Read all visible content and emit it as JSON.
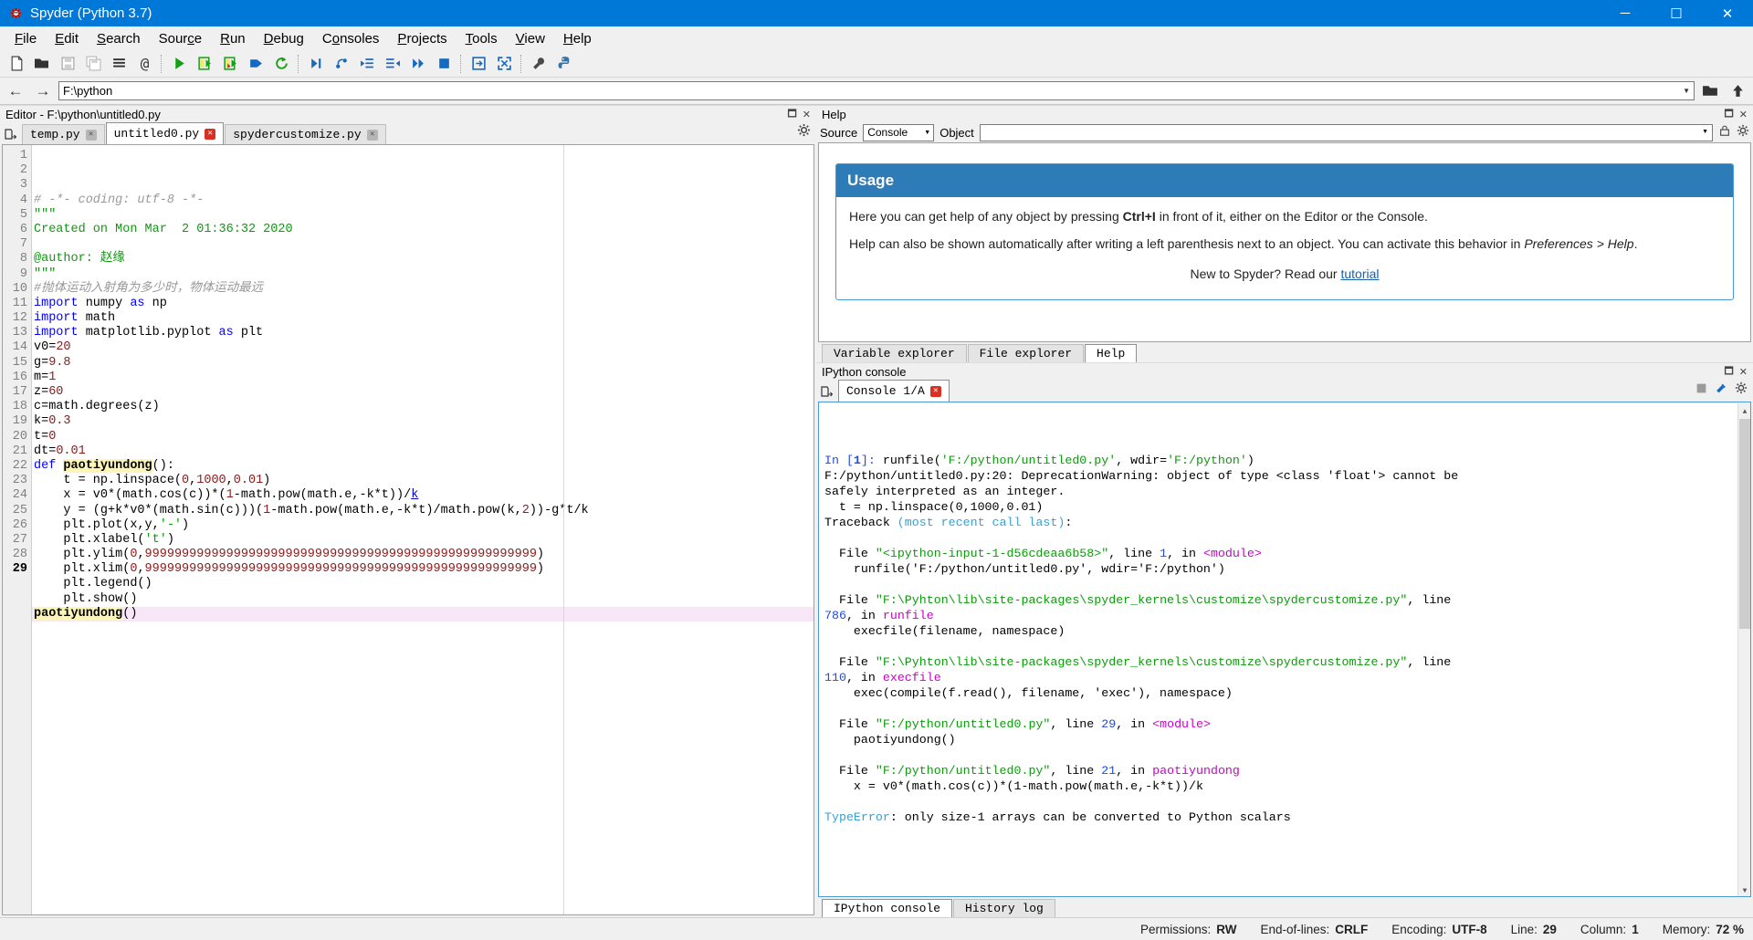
{
  "window": {
    "title": "Spyder (Python 3.7)",
    "icon": "spyder-logo-icon",
    "minimize": "─",
    "maximize": "☐",
    "close": "✕"
  },
  "menubar": [
    {
      "label": "File",
      "accel": "F"
    },
    {
      "label": "Edit",
      "accel": "E"
    },
    {
      "label": "Search",
      "accel": "S"
    },
    {
      "label": "Source",
      "accel": "c"
    },
    {
      "label": "Run",
      "accel": "R"
    },
    {
      "label": "Debug",
      "accel": "D"
    },
    {
      "label": "Consoles",
      "accel": "o"
    },
    {
      "label": "Projects",
      "accel": "P"
    },
    {
      "label": "Tools",
      "accel": "T"
    },
    {
      "label": "View",
      "accel": "V"
    },
    {
      "label": "Help",
      "accel": "H"
    }
  ],
  "toolbar": {
    "groups": [
      [
        "new-file-icon",
        "open-file-icon",
        "save-file-icon",
        "save-all-icon",
        "file-list-icon",
        "at-icon"
      ],
      [
        "run-icon",
        "run-cell-icon",
        "run-cell-advance-icon",
        "run-selection-icon",
        "rerun-icon"
      ],
      [
        "debug-icon",
        "step-over-icon",
        "step-into-icon",
        "step-return-icon",
        "continue-icon",
        "stop-icon"
      ],
      [
        "maximize-pane-icon",
        "fullscreen-icon"
      ],
      [
        "preferences-icon",
        "python-path-icon"
      ]
    ]
  },
  "pathbar": {
    "back": "←",
    "forward": "→",
    "path": "F:\\python",
    "parent_icon": "open-folder-icon",
    "up_icon": "up-arrow-icon"
  },
  "editor": {
    "pane_title": "Editor - F:\\python\\untitled0.py",
    "browse_icon": "browse-tabs-icon",
    "options_icon": "options-gear-icon",
    "undock_icon": "undock-icon",
    "close_icon": "close-pane-icon",
    "tabs": [
      {
        "label": "temp.py",
        "active": false,
        "close": "✕"
      },
      {
        "label": "untitled0.py",
        "active": true,
        "close": "✕"
      },
      {
        "label": "spydercustomize.py",
        "active": false,
        "close": "✕"
      }
    ],
    "current_line": 29,
    "lines": [
      {
        "n": 1,
        "tokens": [
          {
            "t": "# -*- coding: utf-8 -*-",
            "c": "cm"
          }
        ]
      },
      {
        "n": 2,
        "tokens": [
          {
            "t": "\"\"\"",
            "c": "str"
          }
        ]
      },
      {
        "n": 3,
        "tokens": [
          {
            "t": "Created on Mon Mar  2 01:36:32 2020",
            "c": "str"
          }
        ]
      },
      {
        "n": 4,
        "tokens": [
          {
            "t": "",
            "c": "str"
          }
        ]
      },
      {
        "n": 5,
        "tokens": [
          {
            "t": "@author: 赵缘",
            "c": "str"
          }
        ]
      },
      {
        "n": 6,
        "tokens": [
          {
            "t": "\"\"\"",
            "c": "str"
          }
        ]
      },
      {
        "n": 7,
        "tokens": [
          {
            "t": "#抛体运动入射角为多少时，物体运动最远",
            "c": "cm"
          }
        ]
      },
      {
        "n": 8,
        "tokens": [
          {
            "t": "import",
            "c": "kw"
          },
          {
            "t": " numpy ",
            "c": "plain"
          },
          {
            "t": "as",
            "c": "kw"
          },
          {
            "t": " np",
            "c": "plain"
          }
        ]
      },
      {
        "n": 9,
        "tokens": [
          {
            "t": "import",
            "c": "kw"
          },
          {
            "t": " math",
            "c": "plain"
          }
        ]
      },
      {
        "n": 10,
        "tokens": [
          {
            "t": "import",
            "c": "kw"
          },
          {
            "t": " matplotlib.pyplot ",
            "c": "plain"
          },
          {
            "t": "as",
            "c": "kw"
          },
          {
            "t": " plt",
            "c": "plain"
          }
        ]
      },
      {
        "n": 11,
        "tokens": [
          {
            "t": "v0=",
            "c": "plain"
          },
          {
            "t": "20",
            "c": "num"
          }
        ]
      },
      {
        "n": 12,
        "tokens": [
          {
            "t": "g=",
            "c": "plain"
          },
          {
            "t": "9.8",
            "c": "num"
          }
        ]
      },
      {
        "n": 13,
        "tokens": [
          {
            "t": "m=",
            "c": "plain"
          },
          {
            "t": "1",
            "c": "num"
          }
        ]
      },
      {
        "n": 14,
        "tokens": [
          {
            "t": "z=",
            "c": "plain"
          },
          {
            "t": "60",
            "c": "num"
          }
        ]
      },
      {
        "n": 15,
        "tokens": [
          {
            "t": "c=math.degrees(z)",
            "c": "plain"
          }
        ]
      },
      {
        "n": 16,
        "tokens": [
          {
            "t": "k=",
            "c": "plain"
          },
          {
            "t": "0.3",
            "c": "num"
          }
        ]
      },
      {
        "n": 17,
        "tokens": [
          {
            "t": "t=",
            "c": "plain"
          },
          {
            "t": "0",
            "c": "num"
          }
        ]
      },
      {
        "n": 18,
        "tokens": [
          {
            "t": "dt=",
            "c": "plain"
          },
          {
            "t": "0.01",
            "c": "num"
          }
        ]
      },
      {
        "n": 19,
        "tokens": [
          {
            "t": "def",
            "c": "kw"
          },
          {
            "t": " ",
            "c": "plain"
          },
          {
            "t": "paotiyundong",
            "c": "def"
          },
          {
            "t": "():",
            "c": "plain"
          }
        ]
      },
      {
        "n": 20,
        "tokens": [
          {
            "t": "    t = np.linspace(",
            "c": "plain"
          },
          {
            "t": "0",
            "c": "num"
          },
          {
            "t": ",",
            "c": "plain"
          },
          {
            "t": "1000",
            "c": "num"
          },
          {
            "t": ",",
            "c": "plain"
          },
          {
            "t": "0.01",
            "c": "num"
          },
          {
            "t": ")",
            "c": "plain"
          }
        ]
      },
      {
        "n": 21,
        "tokens": [
          {
            "t": "    x = v0*(math.cos(c))*(",
            "c": "plain"
          },
          {
            "t": "1",
            "c": "num"
          },
          {
            "t": "-math.pow(math.e,-k*t))/",
            "c": "plain"
          },
          {
            "t": "k",
            "c": "link"
          }
        ]
      },
      {
        "n": 22,
        "tokens": [
          {
            "t": "    y = (g+k*v0*(math.sin(c)))(",
            "c": "plain"
          },
          {
            "t": "1",
            "c": "num"
          },
          {
            "t": "-math.pow(math.e,-k*t)/math.pow(k,",
            "c": "plain"
          },
          {
            "t": "2",
            "c": "num"
          },
          {
            "t": "))-g*t/k",
            "c": "plain"
          }
        ]
      },
      {
        "n": 23,
        "tokens": [
          {
            "t": "    plt.plot(x,y,",
            "c": "plain"
          },
          {
            "t": "'-'",
            "c": "str"
          },
          {
            "t": ")",
            "c": "plain"
          }
        ]
      },
      {
        "n": 24,
        "tokens": [
          {
            "t": "    plt.xlabel(",
            "c": "plain"
          },
          {
            "t": "'t'",
            "c": "str"
          },
          {
            "t": ")",
            "c": "plain"
          }
        ]
      },
      {
        "n": 25,
        "tokens": [
          {
            "t": "    plt.ylim(",
            "c": "plain"
          },
          {
            "t": "0",
            "c": "num"
          },
          {
            "t": ",",
            "c": "plain"
          },
          {
            "t": "99999999999999999999999999999999999999999999999999999",
            "c": "num"
          },
          {
            "t": ")",
            "c": "plain"
          }
        ]
      },
      {
        "n": 26,
        "tokens": [
          {
            "t": "    plt.xlim(",
            "c": "plain"
          },
          {
            "t": "0",
            "c": "num"
          },
          {
            "t": ",",
            "c": "plain"
          },
          {
            "t": "99999999999999999999999999999999999999999999999999999",
            "c": "num"
          },
          {
            "t": ")",
            "c": "plain"
          }
        ]
      },
      {
        "n": 27,
        "tokens": [
          {
            "t": "    plt.legend()",
            "c": "plain"
          }
        ]
      },
      {
        "n": 28,
        "tokens": [
          {
            "t": "    plt.show()",
            "c": "plain"
          }
        ]
      },
      {
        "n": 29,
        "tokens": [
          {
            "t": "paotiyundong",
            "c": "def"
          },
          {
            "t": "()",
            "c": "plain"
          }
        ]
      }
    ]
  },
  "help": {
    "pane_title": "Help",
    "source_label": "Source",
    "source_value": "Console",
    "object_label": "Object",
    "object_value": "",
    "lock_icon": "lock-icon",
    "gear_icon": "options-gear-icon",
    "undock_icon": "undock-icon",
    "close_icon": "close-pane-icon",
    "card_title": "Usage",
    "paragraph1_a": "Here you can get help of any object by pressing ",
    "paragraph1_b": "Ctrl+I",
    "paragraph1_c": " in front of it, either on the Editor or the Console.",
    "paragraph2_a": "Help can also be shown automatically after writing a left parenthesis next to an object. You can activate this behavior in ",
    "paragraph2_b": "Preferences > Help",
    "paragraph2_c": ".",
    "footer_text": "New to Spyder? Read our ",
    "footer_link": "tutorial"
  },
  "bottom_tabs": [
    {
      "label": "Variable explorer",
      "active": false
    },
    {
      "label": "File explorer",
      "active": false
    },
    {
      "label": "Help",
      "active": true
    }
  ],
  "console": {
    "pane_title": "IPython console",
    "undock_icon": "undock-icon",
    "close_icon": "close-pane-icon",
    "browse_icon": "browse-tabs-icon",
    "tab_label": "Console 1/A",
    "tab_close": "✕",
    "stop_icon": "stop-icon",
    "menu_icon": "console-menu-icon",
    "gear_icon": "options-gear-icon",
    "lines": [
      [
        {
          "t": "In [",
          "c": "c-dblue"
        },
        {
          "t": "1",
          "c": "c-dblue c-bold"
        },
        {
          "t": "]: ",
          "c": "c-dblue"
        },
        {
          "t": "runfile(",
          "c": "c-blk"
        },
        {
          "t": "'F:/python/untitled0.py'",
          "c": "c-green"
        },
        {
          "t": ", wdir=",
          "c": "c-blk"
        },
        {
          "t": "'F:/python'",
          "c": "c-green"
        },
        {
          "t": ")",
          "c": "c-blk"
        }
      ],
      [
        {
          "t": "F:/python/untitled0.py:20: DeprecationWarning: object of type <class 'float'> cannot be",
          "c": "c-blk"
        }
      ],
      [
        {
          "t": "safely interpreted as an integer.",
          "c": "c-blk"
        }
      ],
      [
        {
          "t": "  t = np.linspace(0,1000,0.01)",
          "c": "c-blk"
        }
      ],
      [
        {
          "t": "Traceback ",
          "c": "c-blk"
        },
        {
          "t": "(most recent call last)",
          "c": "c-cyan"
        },
        {
          "t": ":",
          "c": "c-blk"
        }
      ],
      [
        {
          "t": "",
          "c": "c-blk"
        }
      ],
      [
        {
          "t": "  File ",
          "c": "c-blk"
        },
        {
          "t": "\"<ipython-input-1-d56cdeaa6b58>\"",
          "c": "c-green"
        },
        {
          "t": ", line ",
          "c": "c-blk"
        },
        {
          "t": "1",
          "c": "c-dblue"
        },
        {
          "t": ", in ",
          "c": "c-blk"
        },
        {
          "t": "<module>",
          "c": "c-mag"
        }
      ],
      [
        {
          "t": "    runfile('F:/python/untitled0.py', wdir='F:/python')",
          "c": "c-blk"
        }
      ],
      [
        {
          "t": "",
          "c": "c-blk"
        }
      ],
      [
        {
          "t": "  File ",
          "c": "c-blk"
        },
        {
          "t": "\"F:\\Pyhton\\lib\\site-packages\\spyder_kernels\\customize\\spydercustomize.py\"",
          "c": "c-green"
        },
        {
          "t": ", line",
          "c": "c-blk"
        }
      ],
      [
        {
          "t": "786",
          "c": "c-dblue"
        },
        {
          "t": ", in ",
          "c": "c-blk"
        },
        {
          "t": "runfile",
          "c": "c-mag"
        }
      ],
      [
        {
          "t": "    execfile(filename, namespace)",
          "c": "c-blk"
        }
      ],
      [
        {
          "t": "",
          "c": "c-blk"
        }
      ],
      [
        {
          "t": "  File ",
          "c": "c-blk"
        },
        {
          "t": "\"F:\\Pyhton\\lib\\site-packages\\spyder_kernels\\customize\\spydercustomize.py\"",
          "c": "c-green"
        },
        {
          "t": ", line",
          "c": "c-blk"
        }
      ],
      [
        {
          "t": "110",
          "c": "c-dblue"
        },
        {
          "t": ", in ",
          "c": "c-blk"
        },
        {
          "t": "execfile",
          "c": "c-mag"
        }
      ],
      [
        {
          "t": "    exec(compile(f.read(), filename, 'exec'), namespace)",
          "c": "c-blk"
        }
      ],
      [
        {
          "t": "",
          "c": "c-blk"
        }
      ],
      [
        {
          "t": "  File ",
          "c": "c-blk"
        },
        {
          "t": "\"F:/python/untitled0.py\"",
          "c": "c-green"
        },
        {
          "t": ", line ",
          "c": "c-blk"
        },
        {
          "t": "29",
          "c": "c-dblue"
        },
        {
          "t": ", in ",
          "c": "c-blk"
        },
        {
          "t": "<module>",
          "c": "c-mag"
        }
      ],
      [
        {
          "t": "    paotiyundong()",
          "c": "c-blk"
        }
      ],
      [
        {
          "t": "",
          "c": "c-blk"
        }
      ],
      [
        {
          "t": "  File ",
          "c": "c-blk"
        },
        {
          "t": "\"F:/python/untitled0.py\"",
          "c": "c-green"
        },
        {
          "t": ", line ",
          "c": "c-blk"
        },
        {
          "t": "21",
          "c": "c-dblue"
        },
        {
          "t": ", in ",
          "c": "c-blk"
        },
        {
          "t": "paotiyundong",
          "c": "c-mag"
        }
      ],
      [
        {
          "t": "    x = v0*(math.cos(c))*(1-math.pow(math.e,-k*t))/k",
          "c": "c-blk"
        }
      ],
      [
        {
          "t": "",
          "c": "c-blk"
        }
      ],
      [
        {
          "t": "TypeError",
          "c": "c-cyan"
        },
        {
          "t": ": only size-1 arrays can be converted to Python scalars",
          "c": "c-blk"
        }
      ]
    ],
    "footer_tabs": [
      {
        "label": "IPython console",
        "active": true
      },
      {
        "label": "History log",
        "active": false
      }
    ]
  },
  "statusbar": [
    {
      "key": "Permissions:",
      "value": "RW"
    },
    {
      "key": "End-of-lines:",
      "value": "CRLF"
    },
    {
      "key": "Encoding:",
      "value": "UTF-8"
    },
    {
      "key": "Line:",
      "value": "29"
    },
    {
      "key": "Column:",
      "value": "1"
    },
    {
      "key": "Memory:",
      "value": "72 %"
    }
  ]
}
